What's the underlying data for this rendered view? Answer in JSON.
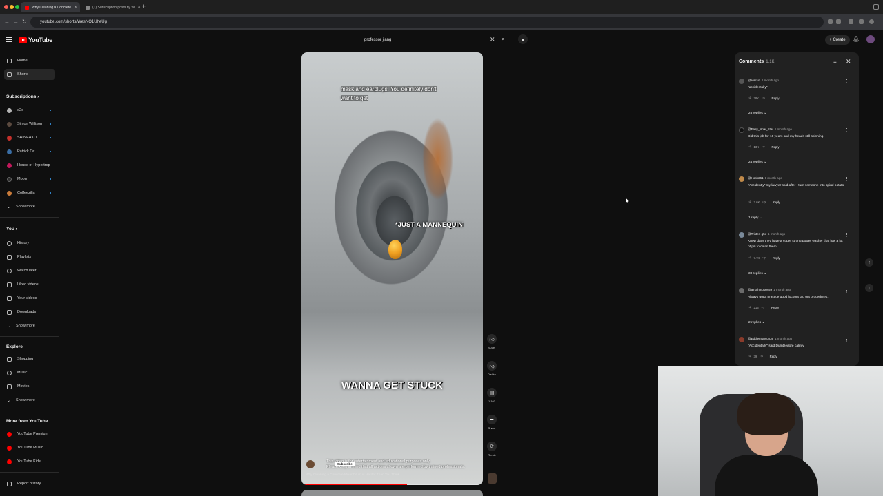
{
  "browser": {
    "tabs": [
      {
        "title": "Why Cleaning a Concrete",
        "active": true
      },
      {
        "title": "(1) Subscription posts by W",
        "active": false
      }
    ],
    "url": "youtube.com/shorts/WesNO1UheUg"
  },
  "header": {
    "logo_text": "YouTube",
    "search_value": "professor jiang",
    "create_label": "Create"
  },
  "sidebar": {
    "main": [
      {
        "label": "Home",
        "icon": "home-icon"
      },
      {
        "label": "Shorts",
        "icon": "shorts-icon",
        "active": true
      }
    ],
    "subscriptions_title": "Subscriptions",
    "subscriptions": [
      {
        "label": "e2c",
        "color": "#b5b5b5"
      },
      {
        "label": "Simon Willison",
        "color": "#5b4a3f"
      },
      {
        "label": "SHINEAKO",
        "color": "#c4302b"
      },
      {
        "label": "Patrick Oc",
        "color": "#3a6ea5"
      },
      {
        "label": "House of Hypertrop",
        "color": "#c2185b"
      },
      {
        "label": "Moon",
        "color": "#2b2b2b"
      },
      {
        "label": "Coffeezilla",
        "color": "#c97b3a"
      }
    ],
    "subscriptions_more": "Show more",
    "you_title": "You",
    "you": [
      {
        "label": "History",
        "icon": "history-icon"
      },
      {
        "label": "Playlists",
        "icon": "playlists-icon"
      },
      {
        "label": "Watch later",
        "icon": "watch-later-icon"
      },
      {
        "label": "Liked videos",
        "icon": "liked-videos-icon"
      },
      {
        "label": "Your videos",
        "icon": "your-videos-icon"
      },
      {
        "label": "Downloads",
        "icon": "downloads-icon"
      }
    ],
    "you_more": "Show more",
    "explore_title": "Explore",
    "explore": [
      {
        "label": "Shopping",
        "icon": "shopping-icon"
      },
      {
        "label": "Music",
        "icon": "music-icon"
      },
      {
        "label": "Movies",
        "icon": "movies-icon"
      }
    ],
    "explore_more": "Show more",
    "more_title": "More from YouTube",
    "more": [
      {
        "label": "YouTube Premium"
      },
      {
        "label": "YouTube Music"
      },
      {
        "label": "YouTube Kids"
      }
    ],
    "report": "Report history"
  },
  "video": {
    "caption_line1": "mask and earplugs. You definitely don't",
    "caption_line2": "want to get",
    "overlay_label": "*JUST A MANNEQUIN",
    "overlay_big": "WANNA GET STUCK",
    "disclaimer_line1": "This video is for entertainment and educational purposes only.",
    "disclaimer_line2": "Please keep in mind that all actions shown are performed by trained professionals.",
    "subscribe_label": "Subscribe",
    "title": "Why Cleaning a Concrete Mixer Drum is Harder Than You Think",
    "progress": 0.58
  },
  "actions": {
    "like_count": "601K",
    "dislike_label": "Dislike",
    "comments_count": "1,103",
    "share_label": "Share",
    "remix_label": "Remix"
  },
  "comments": {
    "title": "Comments",
    "count": "1.1K",
    "reply_label": "Reply",
    "items": [
      {
        "author": "@Viscurl",
        "time": "1 month ago",
        "text": "\"accidentally\"",
        "likes": "28K",
        "replies": "25 replies",
        "color": "#555"
      },
      {
        "author": "@Easy_Now_Star",
        "time": "1 month ago",
        "text": "Did this job for 10 years and my heads still spinning.",
        "likes": "13K",
        "replies": "24 replies",
        "color": "#111"
      },
      {
        "author": "@Hosh261",
        "time": "1 month ago",
        "text": "\"Accidently\" my lawyer said after I turn someone into spiral potato",
        "likes": "2.6K",
        "replies": "1 reply",
        "color": "#c08a4a"
      },
      {
        "author": "@Tristen-q5o",
        "time": "1 month ago",
        "text": "Know days they have a super strong power washer that has a lot of psi to clean them",
        "likes": "7.7K",
        "replies": "30 replies",
        "color": "#7a8a9a"
      },
      {
        "author": "@airschmoopy59",
        "time": "1 month ago",
        "text": "Always gotta practice good lockout tag out procedures.",
        "likes": "215",
        "replies": "2 replies",
        "color": "#6b6b6b"
      },
      {
        "author": "@Eddiemunson36",
        "time": "1 month ago",
        "text": "\"Accidentally\" said Dumbledore calmly",
        "likes": "39",
        "replies": "",
        "color": "#8a3b2b"
      }
    ]
  }
}
